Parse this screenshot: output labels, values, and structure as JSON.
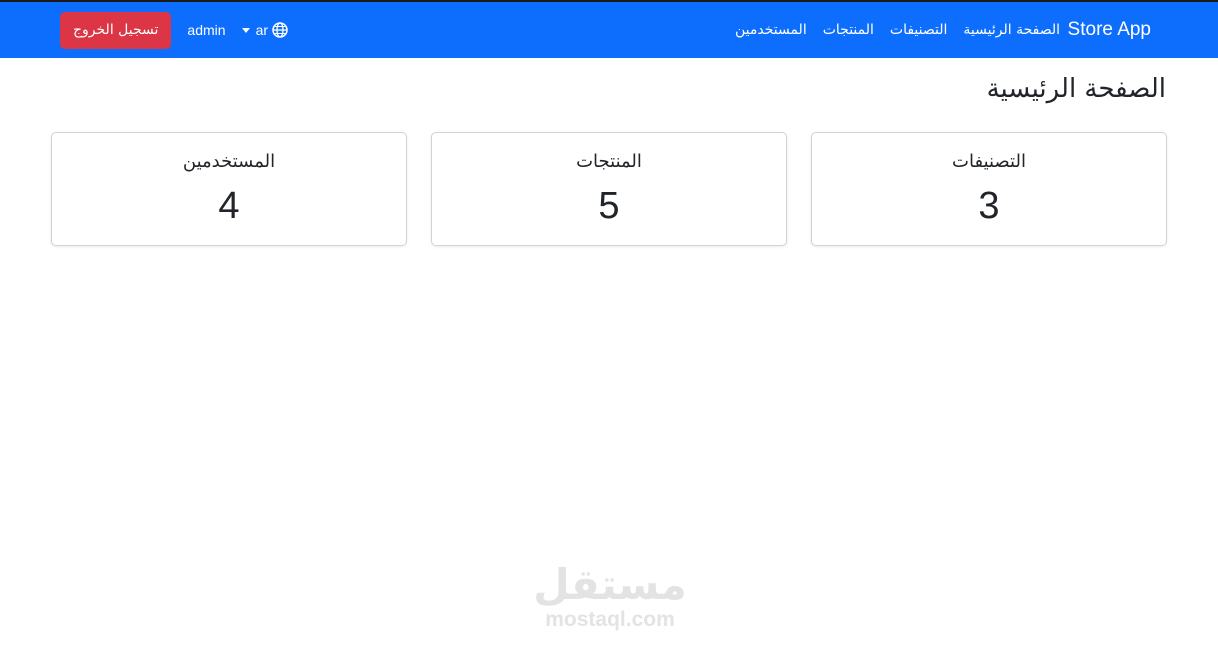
{
  "navbar": {
    "brand": "Store App",
    "links": [
      {
        "label": "الصفحة الرئيسية"
      },
      {
        "label": "التصنيفات"
      },
      {
        "label": "المنتجات"
      },
      {
        "label": "المستخدمين"
      }
    ],
    "language": "ar",
    "username": "admin",
    "logout_label": "تسجيل الخروج",
    "bg_color": "#0d6efd"
  },
  "main": {
    "title": "الصفحة الرئيسية",
    "cards": [
      {
        "label": "التصنيفات",
        "value": "3"
      },
      {
        "label": "المنتجات",
        "value": "5"
      },
      {
        "label": "المستخدمين",
        "value": "4"
      }
    ]
  },
  "watermark": {
    "arabic": "مستقل",
    "latin": "mostaql.com"
  },
  "colors": {
    "primary": "#0d6efd",
    "danger": "#dc3545"
  },
  "icons": {
    "language": "globe-icon",
    "dropdown": "caret-down-icon"
  }
}
